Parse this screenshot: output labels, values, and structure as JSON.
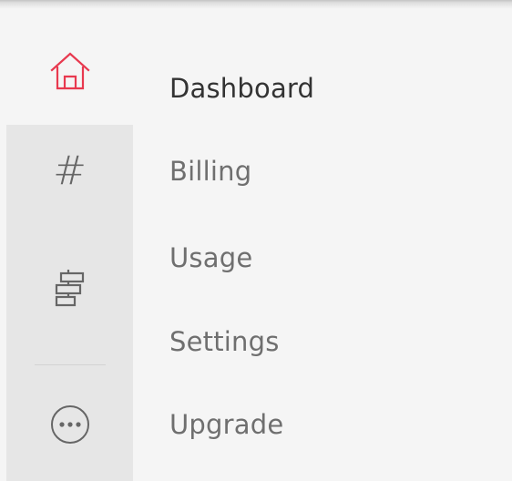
{
  "colors": {
    "accent": "#e8394f",
    "icon": "#666666",
    "rail_selected_bg": "#e6e6e6",
    "panel_bg": "#f5f5f5",
    "label_active": "#333333",
    "label": "#6f6f6f"
  },
  "rail": {
    "icons": [
      {
        "name": "home-icon",
        "active": true
      },
      {
        "name": "hash-icon",
        "glyph": "#"
      },
      {
        "name": "stack-icon"
      },
      {
        "name": "more-icon"
      }
    ]
  },
  "menu": {
    "items": [
      {
        "label": "Dashboard",
        "active": true
      },
      {
        "label": "Billing"
      },
      {
        "label": "Usage"
      },
      {
        "label": "Settings"
      },
      {
        "label": "Upgrade"
      }
    ]
  }
}
